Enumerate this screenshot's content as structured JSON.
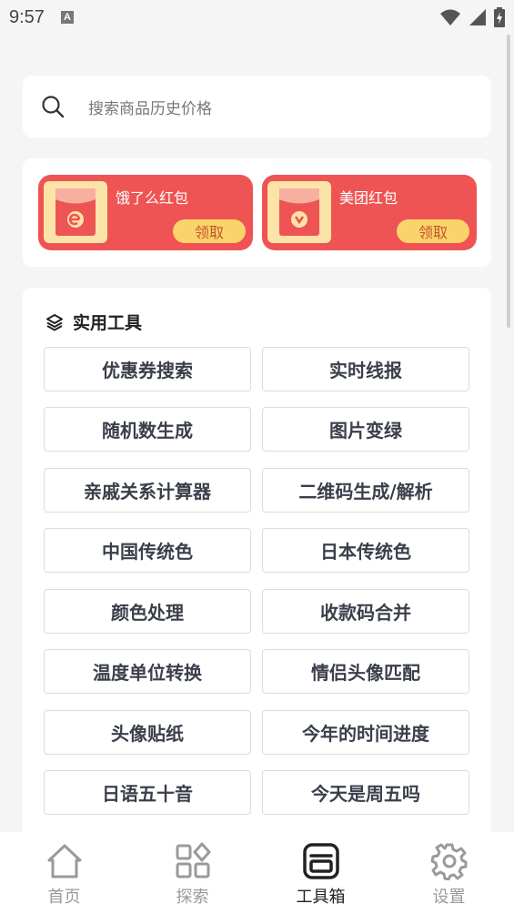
{
  "status": {
    "time": "9:57",
    "notification_glyph": "A"
  },
  "search": {
    "placeholder": "搜索商品历史价格"
  },
  "redpacks": [
    {
      "title": "饿了么红包",
      "button": "领取"
    },
    {
      "title": "美团红包",
      "button": "领取"
    }
  ],
  "tools": {
    "title": "实用工具",
    "items": [
      "优惠券搜索",
      "实时线报",
      "随机数生成",
      "图片变绿",
      "亲戚关系计算器",
      "二维码生成/解析",
      "中国传统色",
      "日本传统色",
      "颜色处理",
      "收款码合并",
      "温度单位转换",
      "情侣头像匹配",
      "头像贴纸",
      "今年的时间进度",
      "日语五十音",
      "今天是周五吗"
    ]
  },
  "tabs": [
    {
      "label": "首页",
      "icon": "home-icon"
    },
    {
      "label": "探索",
      "icon": "explore-grid-icon"
    },
    {
      "label": "工具箱",
      "icon": "toolbox-icon",
      "active": true
    },
    {
      "label": "设置",
      "icon": "settings-gear-icon"
    }
  ],
  "colors": {
    "redpack_bg": "#ee5454",
    "redpack_button": "#fbd36b",
    "tab_active": "#222222",
    "tab_inactive": "#9a9a9a"
  }
}
